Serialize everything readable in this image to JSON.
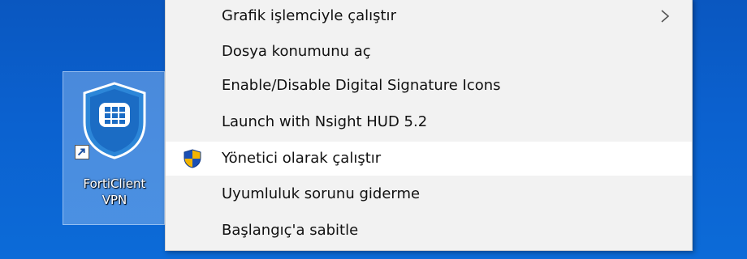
{
  "menu": {
    "items": [
      {
        "label": "Grafik işlemciyle çalıştır"
      },
      {
        "label": "Dosya konumunu aç"
      },
      {
        "label": "Enable/Disable Digital Signature Icons"
      },
      {
        "label": "Launch with Nsight HUD 5.2"
      },
      {
        "label": "Yönetici olarak çalıştır"
      },
      {
        "label": "Uyumluluk sorunu giderme"
      },
      {
        "label": "Başlangıç'a sabitle"
      }
    ]
  },
  "desktop": {
    "shortcut": {
      "label_line1": "FortiClient",
      "label_line2": "VPN",
      "icon": "forticlient-shield-icon"
    }
  },
  "colors": {
    "desktop_bg": "#0b5ec8",
    "menu_bg": "#f2f2f2",
    "hover_bg": "#ffffff",
    "shield_blue": "#1a4fb5",
    "shield_yellow": "#f2b400"
  }
}
